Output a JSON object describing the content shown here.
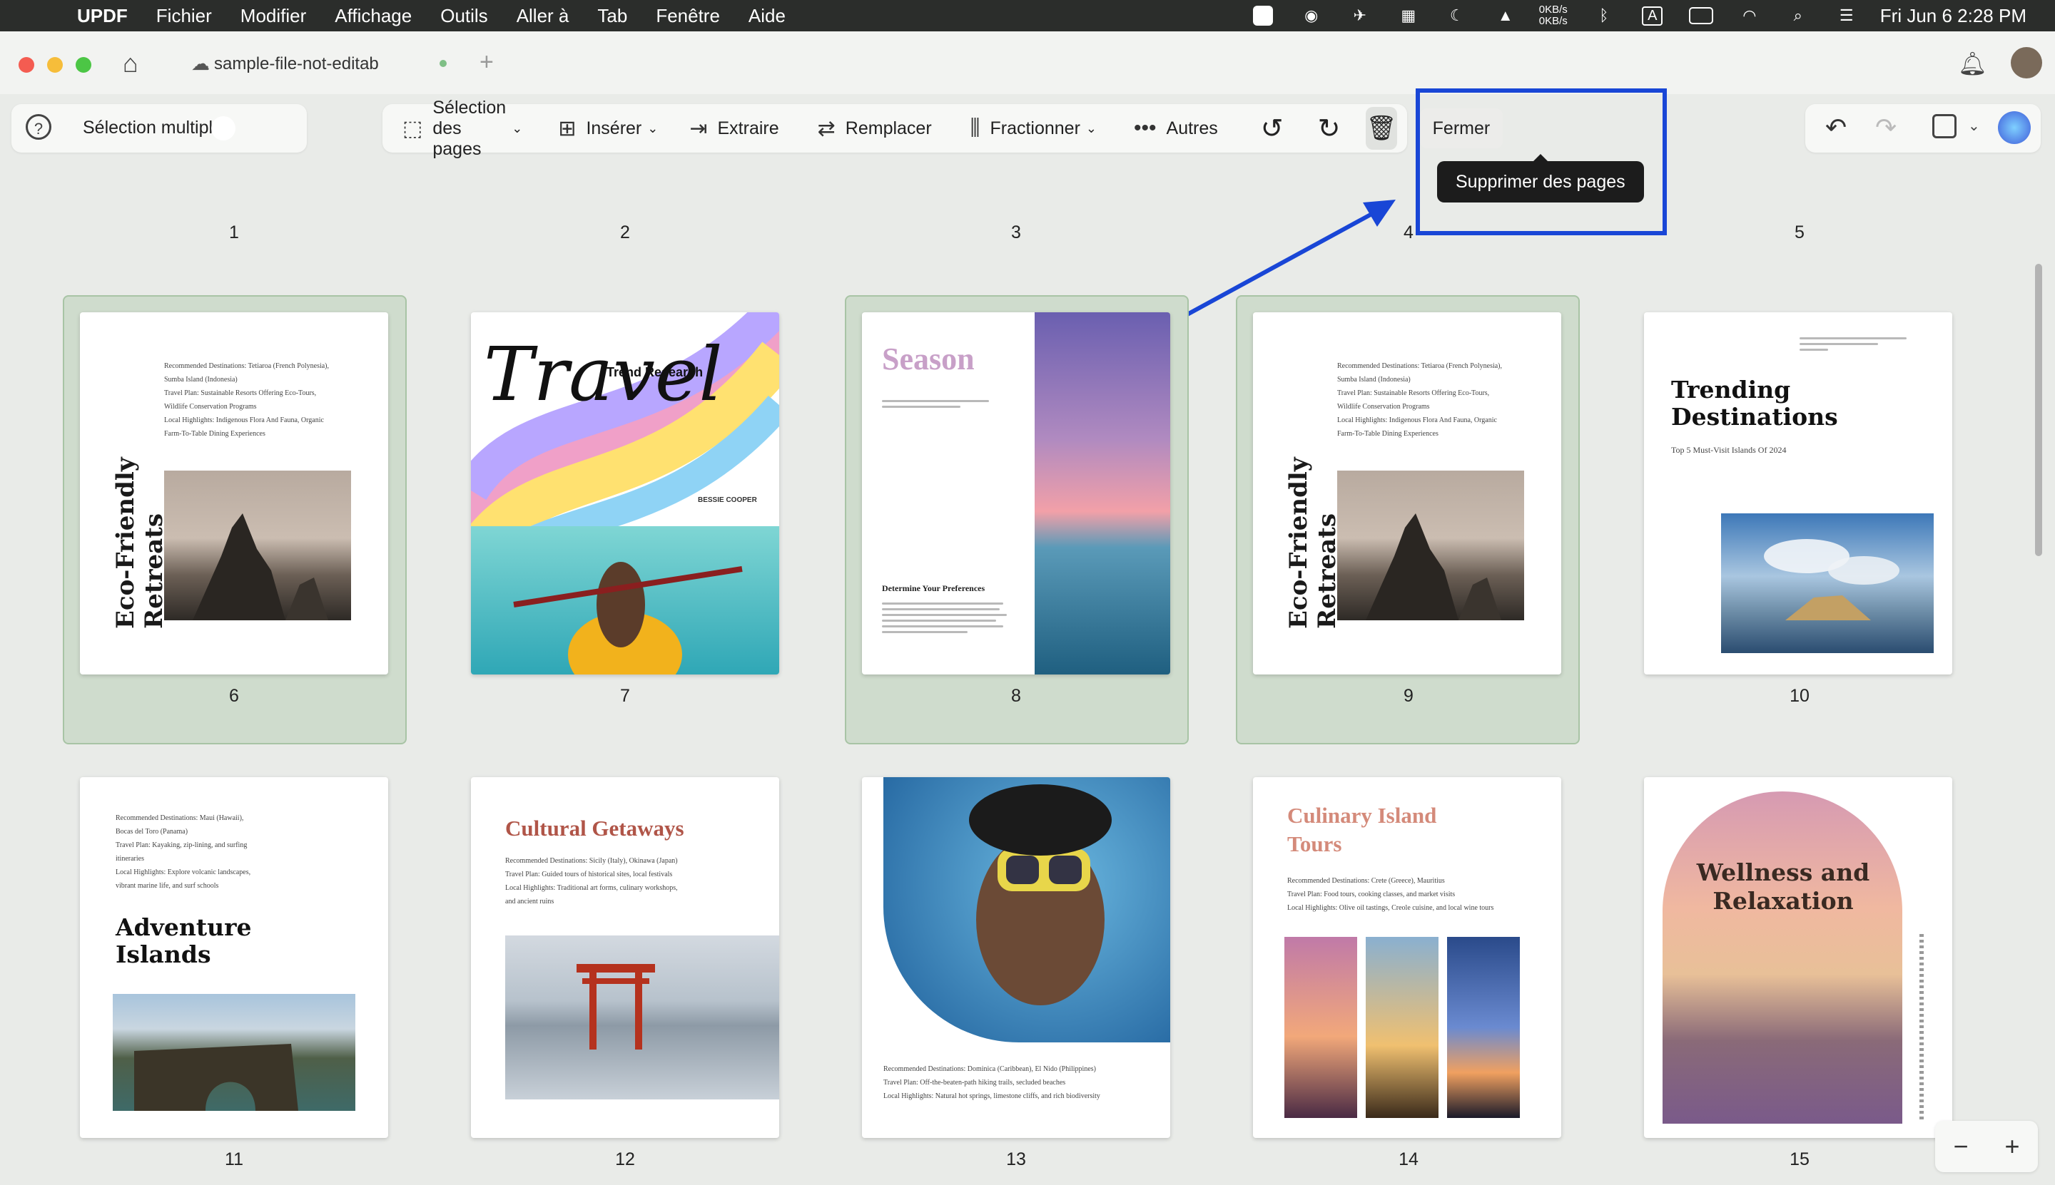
{
  "menubar": {
    "app_name": "UPDF",
    "menus": [
      "Fichier",
      "Modifier",
      "Affichage",
      "Outils",
      "Aller à",
      "Tab",
      "Fenêtre",
      "Aide"
    ],
    "net_up": "0KB/s",
    "net_down": "0KB/s",
    "datetime": "Fri Jun 6  2:28 PM"
  },
  "window": {
    "tab_title": "sample-file-not-editab"
  },
  "toolbar": {
    "multi_select_label": "Sélection multiple",
    "page_select_label": "Sélection des pages",
    "insert_label": "Insérer",
    "extract_label": "Extraire",
    "replace_label": "Remplacer",
    "split_label": "Fractionner",
    "more_label": "Autres",
    "close_label": "Fermer",
    "tooltip": "Supprimer des pages"
  },
  "pages": [
    {
      "num": "1"
    },
    {
      "num": "2"
    },
    {
      "num": "3"
    },
    {
      "num": "4"
    },
    {
      "num": "5"
    },
    {
      "num": "6",
      "title": "Eco-Friendly Retreats",
      "lines": [
        "Recommended Destinations: Tetiaroa (French Polynesia),",
        "Sumba Island (Indonesia)",
        "Travel Plan: Sustainable Resorts Offering Eco-Tours,",
        "Wildlife Conservation Programs",
        "Local Highlights: Indigenous Flora And Fauna, Organic",
        "Farm-To-Table Dining Experiences"
      ]
    },
    {
      "num": "7",
      "title": "Travel",
      "subtitle": "Trend Research",
      "author": "BESSIE COOPER"
    },
    {
      "num": "8",
      "title": "Season",
      "subtitle": "Determine Your Preferences"
    },
    {
      "num": "9",
      "title": "Eco-Friendly Retreats",
      "lines": [
        "Recommended Destinations: Tetiaroa (French Polynesia),",
        "Sumba Island (Indonesia)",
        "Travel Plan: Sustainable Resorts Offering Eco-Tours,",
        "Wildlife Conservation Programs",
        "Local Highlights: Indigenous Flora And Fauna, Organic",
        "Farm-To-Table Dining Experiences"
      ]
    },
    {
      "num": "10",
      "title": "Trending Destinations",
      "subtitle": "Top 5 Must-Visit Islands Of 2024"
    },
    {
      "num": "11",
      "title": "Adventure Islands",
      "lines": [
        "Recommended Destinations: Maui (Hawaii),",
        "Bocas del Toro (Panama)",
        "Travel Plan: Kayaking, zip-lining, and surfing",
        "itineraries",
        "Local Highlights: Explore volcanic landscapes,",
        "vibrant marine life, and surf schools"
      ]
    },
    {
      "num": "12",
      "title": "Cultural Getaways",
      "lines": [
        "Recommended Destinations: Sicily (Italy), Okinawa (Japan)",
        "Travel Plan: Guided tours of historical sites, local festivals",
        "Local Highlights: Traditional art forms, culinary workshops,",
        "and ancient ruins"
      ]
    },
    {
      "num": "13",
      "lines": [
        "Recommended Destinations: Dominica (Caribbean), El Nido (Philippines)",
        "Travel Plan: Off-the-beaten-path hiking trails, secluded beaches",
        "Local Highlights: Natural hot springs, limestone cliffs, and rich biodiversity"
      ]
    },
    {
      "num": "14",
      "title": "Culinary Island Tours",
      "lines": [
        "Recommended Destinations: Crete (Greece), Mauritius",
        "Travel Plan: Food tours, cooking classes, and market visits",
        "Local Highlights: Olive oil tastings, Creole cuisine, and local wine tours"
      ]
    },
    {
      "num": "15",
      "title": "Wellness and Relaxation"
    }
  ],
  "colors": {
    "accent_blue": "#1946d6",
    "toggle_green": "#4caf7a",
    "selected_bg": "#cfdccd"
  },
  "zoom": {
    "minus": "−",
    "plus": "+"
  }
}
